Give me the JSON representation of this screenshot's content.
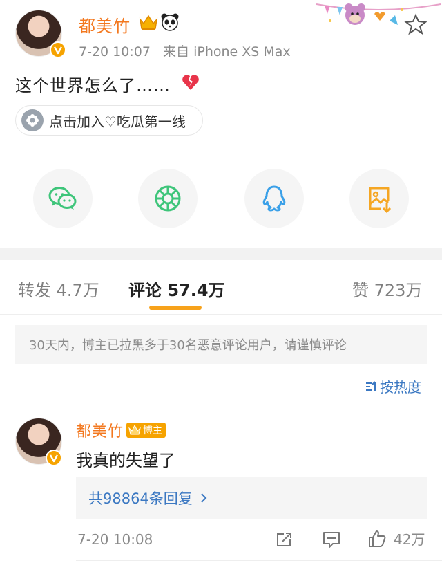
{
  "post": {
    "author": "都美竹",
    "time": "7-20 10:07",
    "source": "来自 iPhone XS Max",
    "text": "这个世界怎么了……",
    "topic": "点击加入♡吃瓜第一线"
  },
  "share": {
    "items": [
      {
        "name": "wechat",
        "icon": "wechat-icon",
        "color": "#3ec57a"
      },
      {
        "name": "moments",
        "icon": "moments-icon",
        "color": "#3ec57a"
      },
      {
        "name": "qq",
        "icon": "qq-icon",
        "color": "#3aa0e8"
      },
      {
        "name": "save-image",
        "icon": "image-download-icon",
        "color": "#f5a623"
      }
    ]
  },
  "tabs": {
    "repost": "转发 4.7万",
    "comments": "评论 57.4万",
    "likes": "赞 723万"
  },
  "notice": "30天内，博主已拉黑多于30名恶意评论用户，请谨慎评论",
  "sort": "按热度",
  "comment": {
    "author": "都美竹",
    "badge": "博主",
    "text": "我真的失望了",
    "replies": "共98864条回复",
    "time": "7-20 10:08",
    "likes": "42万"
  },
  "colors": {
    "accent": "#f3781f",
    "link": "#3b78c2",
    "tab_underline": "#f7a21b"
  }
}
